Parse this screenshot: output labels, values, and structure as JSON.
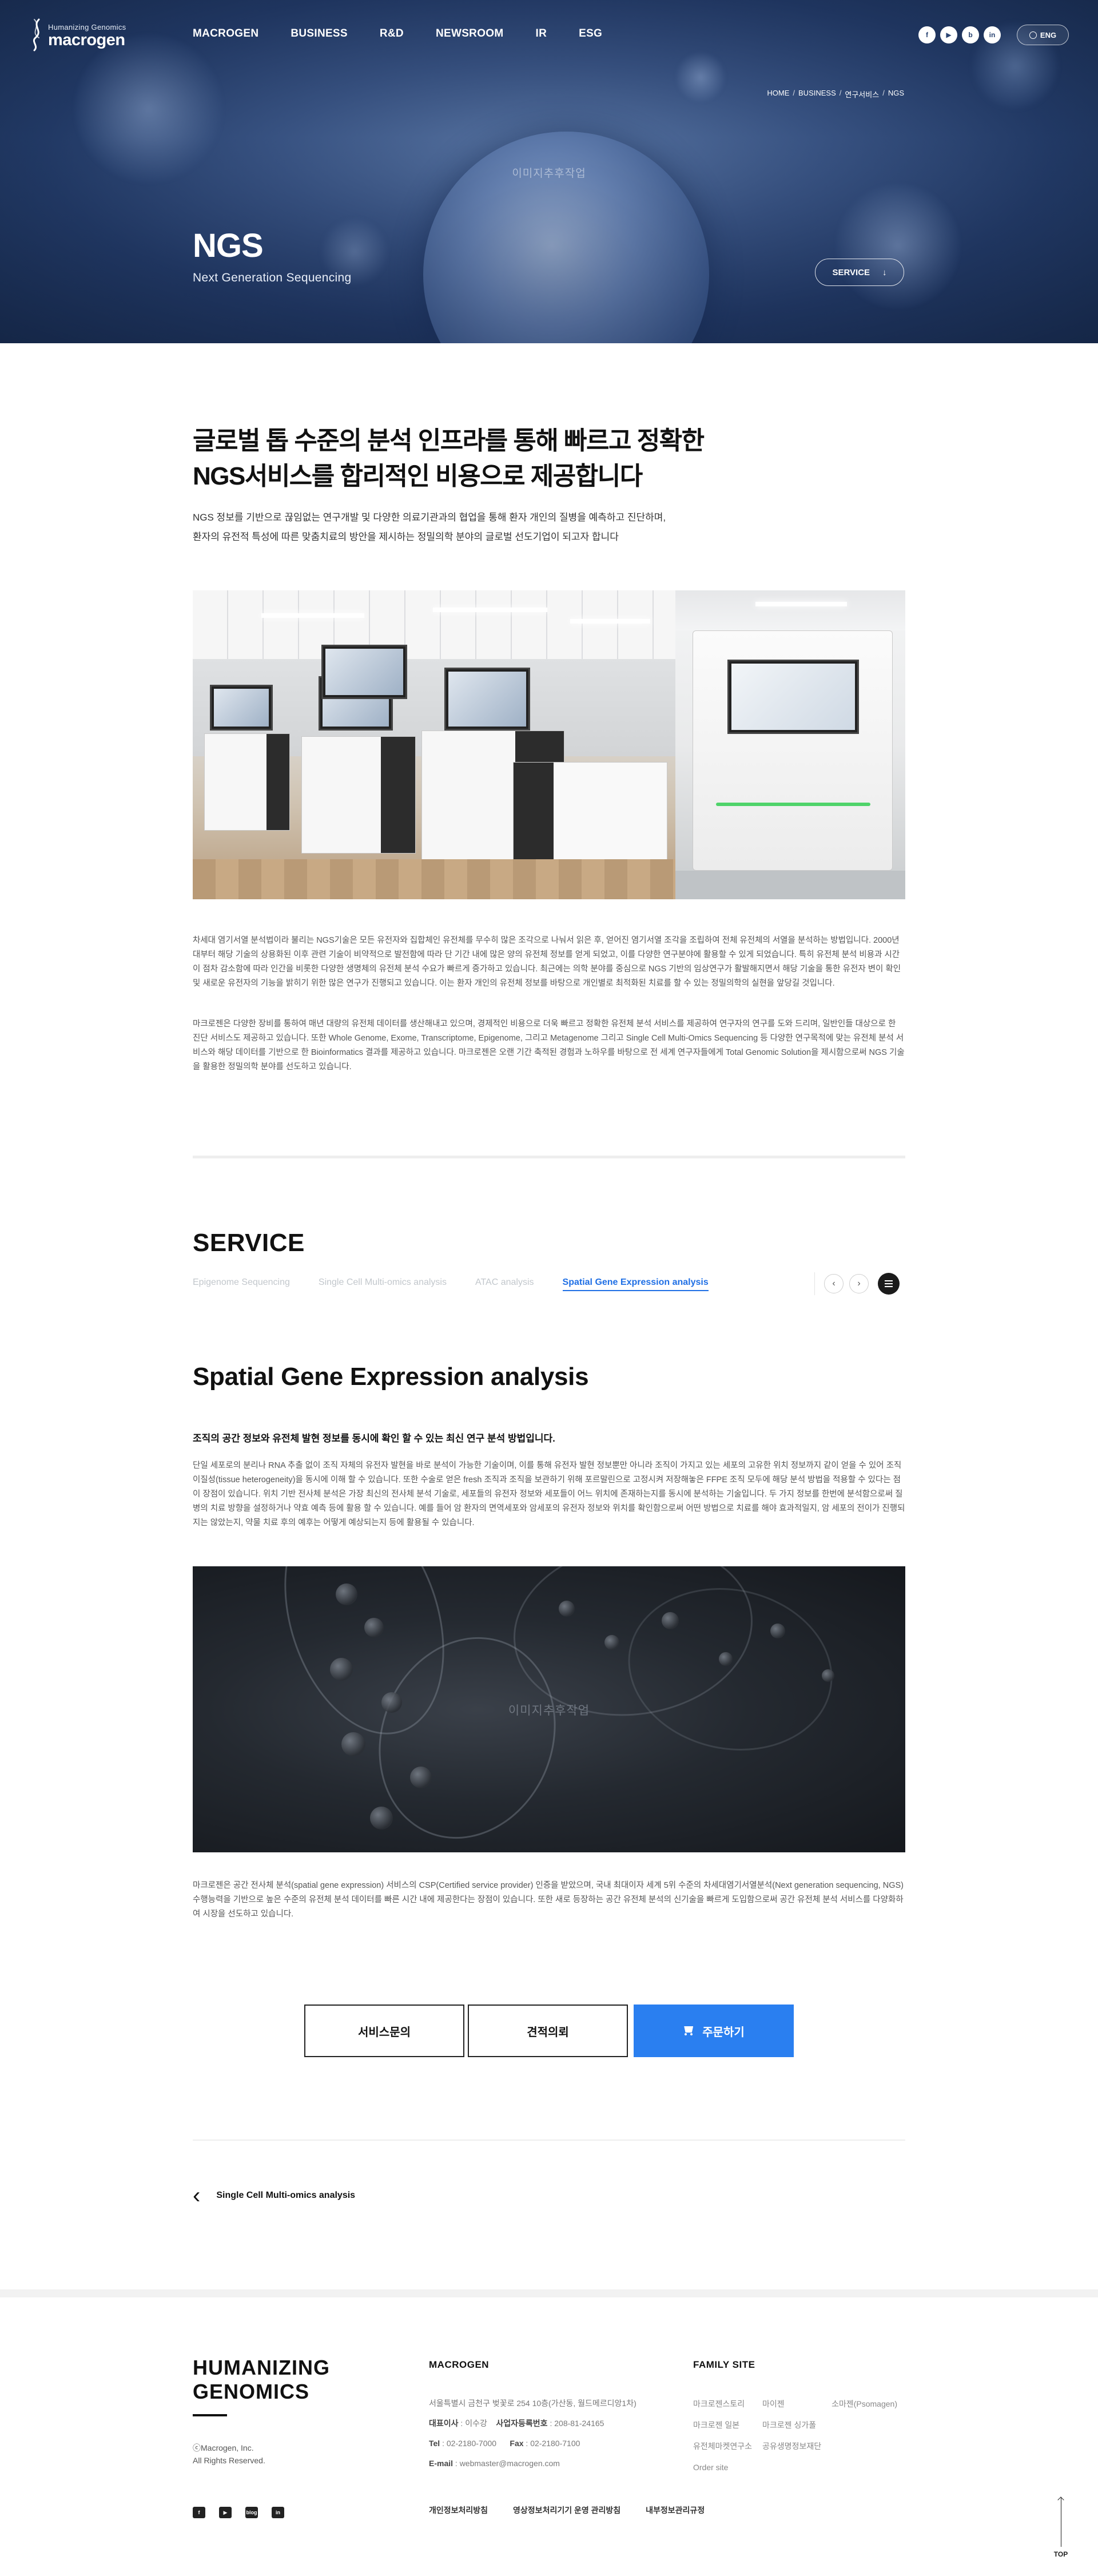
{
  "header": {
    "logo_tagline": "Humanizing Genomics",
    "logo_word": "macrogen",
    "nav": [
      "MACROGEN",
      "BUSINESS",
      "R&D",
      "NEWSROOM",
      "IR",
      "ESG"
    ],
    "sns": [
      "f",
      "▶",
      "b",
      "in"
    ],
    "lang": "ENG"
  },
  "breadcrumb": [
    "HOME",
    "BUSINESS",
    "연구서비스",
    "NGS"
  ],
  "hero": {
    "watermark": "이미지추후작업",
    "title": "NGS",
    "subtitle": "Next Generation Sequencing",
    "service_button": "SERVICE",
    "service_icon": "↓"
  },
  "intro": {
    "title_line1": "글로벌 톱 수준의 분석 인프라를 통해 빠르고 정확한",
    "title_line2": "NGS서비스를 합리적인 비용으로 제공합니다",
    "desc_line1": "NGS 정보를 기반으로 끊임없는 연구개발 및 다양한 의료기관과의 협업을 통해 환자 개인의 질병을 예측하고 진단하며,",
    "desc_line2": "환자의 유전적 특성에 따른 맞춤치료의 방안을 제시하는 정밀의학 분야의 글로벌 선도기업이 되고자 합니다",
    "para1": "차세대 염기서열 분석법이라 불리는 NGS기술은 모든 유전자와 집합체인 유전체를 무수히 많은 조각으로 나눠서 읽은 후, 얻어진 염기서열 조각을 조립하여 전체 유전체의 서열을 분석하는 방법입니다. 2000년대부터 해당 기술의 상용화된 이후 관련 기술이 비약적으로 발전함에 따라 단 기간 내에 많은 양의 유전체 정보를 얻게 되었고, 이를 다양한 연구분야에 활용할 수 있게 되었습니다. 특히 유전체 분석 비용과 시간이 점차 감소함에 따라 인간을 비롯한 다양한 생명체의 유전체 분석 수요가 빠르게 증가하고 있습니다. 최근에는 의학 분야를 중심으로 NGS 기반의 임상연구가 활발해지면서 해당 기술을 통한 유전자 변이 확인 및 새로운 유전자의 기능을 밝히기 위한 많은 연구가 진행되고 있습니다. 이는 환자 개인의 유전체 정보를 바탕으로 개인별로 최적화된 치료를 할 수 있는 정밀의학의 실현을 앞당길 것입니다.",
    "para2": "마크로젠은 다양한 장비를 통하여 매년 대량의 유전체 데이터를 생산해내고 있으며, 경제적인 비용으로 더욱 빠르고 정확한 유전체 분석 서비스를 제공하여 연구자의 연구를 도와 드리며, 일반인들 대상으로 한 진단 서비스도 제공하고 있습니다. 또한 Whole Genome, Exome, Transcriptome, Epigenome, 그리고 Metagenome 그리고 Single Cell Multi-Omics Sequencing 등 다양한 연구목적에 맞는 유전체 분석 서비스와 해당 데이터를 기반으로 한 Bioinformatics 결과를 제공하고 있습니다. 마크로젠은 오랜 기간 축적된 경험과 노하우를 바탕으로 전 세계 연구자들에게 Total Genomic Solution을 제시함으로써 NGS 기술을 활용한 정밀의학 분야를 선도하고 있습니다."
  },
  "service": {
    "title": "SERVICE",
    "tabs": [
      "Epigenome Sequencing",
      "Single Cell Multi-omics analysis",
      "ATAC analysis",
      "Spatial Gene Expression analysis"
    ],
    "active_tab": "Spatial Gene Expression analysis",
    "prev_icon": "‹",
    "next_icon": "›"
  },
  "sge": {
    "title": "Spatial Gene Expression analysis",
    "lead": "조직의 공간 정보와 유전체 발현 정보를 동시에 확인 할 수 있는 최신 연구 분석 방법입니다.",
    "para1": "단일 세포로의 분리나 RNA 추출 없이 조직 자체의 유전자 발현을 바로 분석이 가능한 기술이며, 이를 통해 유전자 발현 정보뿐만 아니라 조직이 가지고 있는 세포의 고유한 위치 정보까지 같이 얻을 수 있어 조직이질성(tissue heterogeneity)을 동시에 이해 할 수 있습니다. 또한 수술로 얻은 fresh 조직과 조직을 보관하기 위해 포르말린으로 고정시켜 저장해놓은 FFPE 조직 모두에 해당 분석 방법을 적용할 수 있다는 점이 장점이 있습니다. 위치 기반 전사체 분석은 가장 최신의 전사체 분석 기술로, 세포들의 유전자 정보와 세포들이 어느 위치에 존재하는지를 동시에 분석하는 기술입니다. 두 가지 정보를 한번에 분석함으로써 질병의 치료 방향을 설정하거나 약효 예측 등에 활용 할 수 있습니다. 예를 들어 암 환자의 면역세포와 암세포의 유전자 정보와 위치를 확인함으로써 어떤 방법으로 치료를 해야 효과적일지, 암 세포의 전이가 진행되지는 않았는지, 약물 치료 후의 예후는 어떻게 예상되는지 등에 활용될 수 있습니다.",
    "image_watermark": "이미지추후작업",
    "para2": "마크로젠은 공간 전사체 분석(spatial gene expression) 서비스의 CSP(Certified service provider) 인증을 받았으며, 국내 최대이자 세계 5위 수준의 차세대염기서열분석(Next generation sequencing, NGS) 수행능력을 기반으로 높은 수준의 유전체 분석 데이터를 빠른 시간 내에 제공한다는 장점이 있습니다. 또한 새로 등장하는 공간 유전체 분석의 신기술을 빠르게 도입함으로써 공간 유전체 분석 서비스를 다양화하여 시장을 선도하고 있습니다."
  },
  "cta": {
    "inquiry": "서비스문의",
    "quote": "견적의뢰",
    "order": "주문하기"
  },
  "prev_page": {
    "icon": "‹",
    "label": "Single Cell Multi-omics analysis"
  },
  "footer": {
    "brand_line1": "HUMANIZING",
    "brand_line2": "GENOMICS",
    "copy_line1": "ⓒMacrogen, Inc.",
    "copy_line2": "All Rights Reserved.",
    "company_title": "MACROGEN",
    "address": "서울특별시 금천구 벚꽃로 254 10층(가산동, 월드메르디앙1차)",
    "ceo_label": "대표이사",
    "ceo": "이수강",
    "biz_label": "사업자등록번호",
    "biz_no": "208-81-24165",
    "tel_label": "Tel",
    "tel": "02-2180-7000",
    "fax_label": "Fax",
    "fax": "02-2180-7100",
    "email_label": "E-mail",
    "email": "webmaster@macrogen.com",
    "family_title": "FAMILY SITE",
    "family": [
      "마크로젠스토리",
      "마이젠",
      "소마젠(Psomagen)",
      "마크로젠 일본",
      "마크로젠 싱가폴",
      "유전체마켓연구소",
      "공유생명정보재단",
      "Order site"
    ],
    "sns": [
      "f",
      "▶",
      "blog",
      "in"
    ],
    "links": [
      "개인정보처리방침",
      "영상정보처리기기 운영 관리방침",
      "내부정보관리규정"
    ],
    "top": "TOP"
  },
  "colors": {
    "accent": "#2a7ff0",
    "tab_active": "#1f6fe5",
    "hero_bg": "#2a4472"
  }
}
